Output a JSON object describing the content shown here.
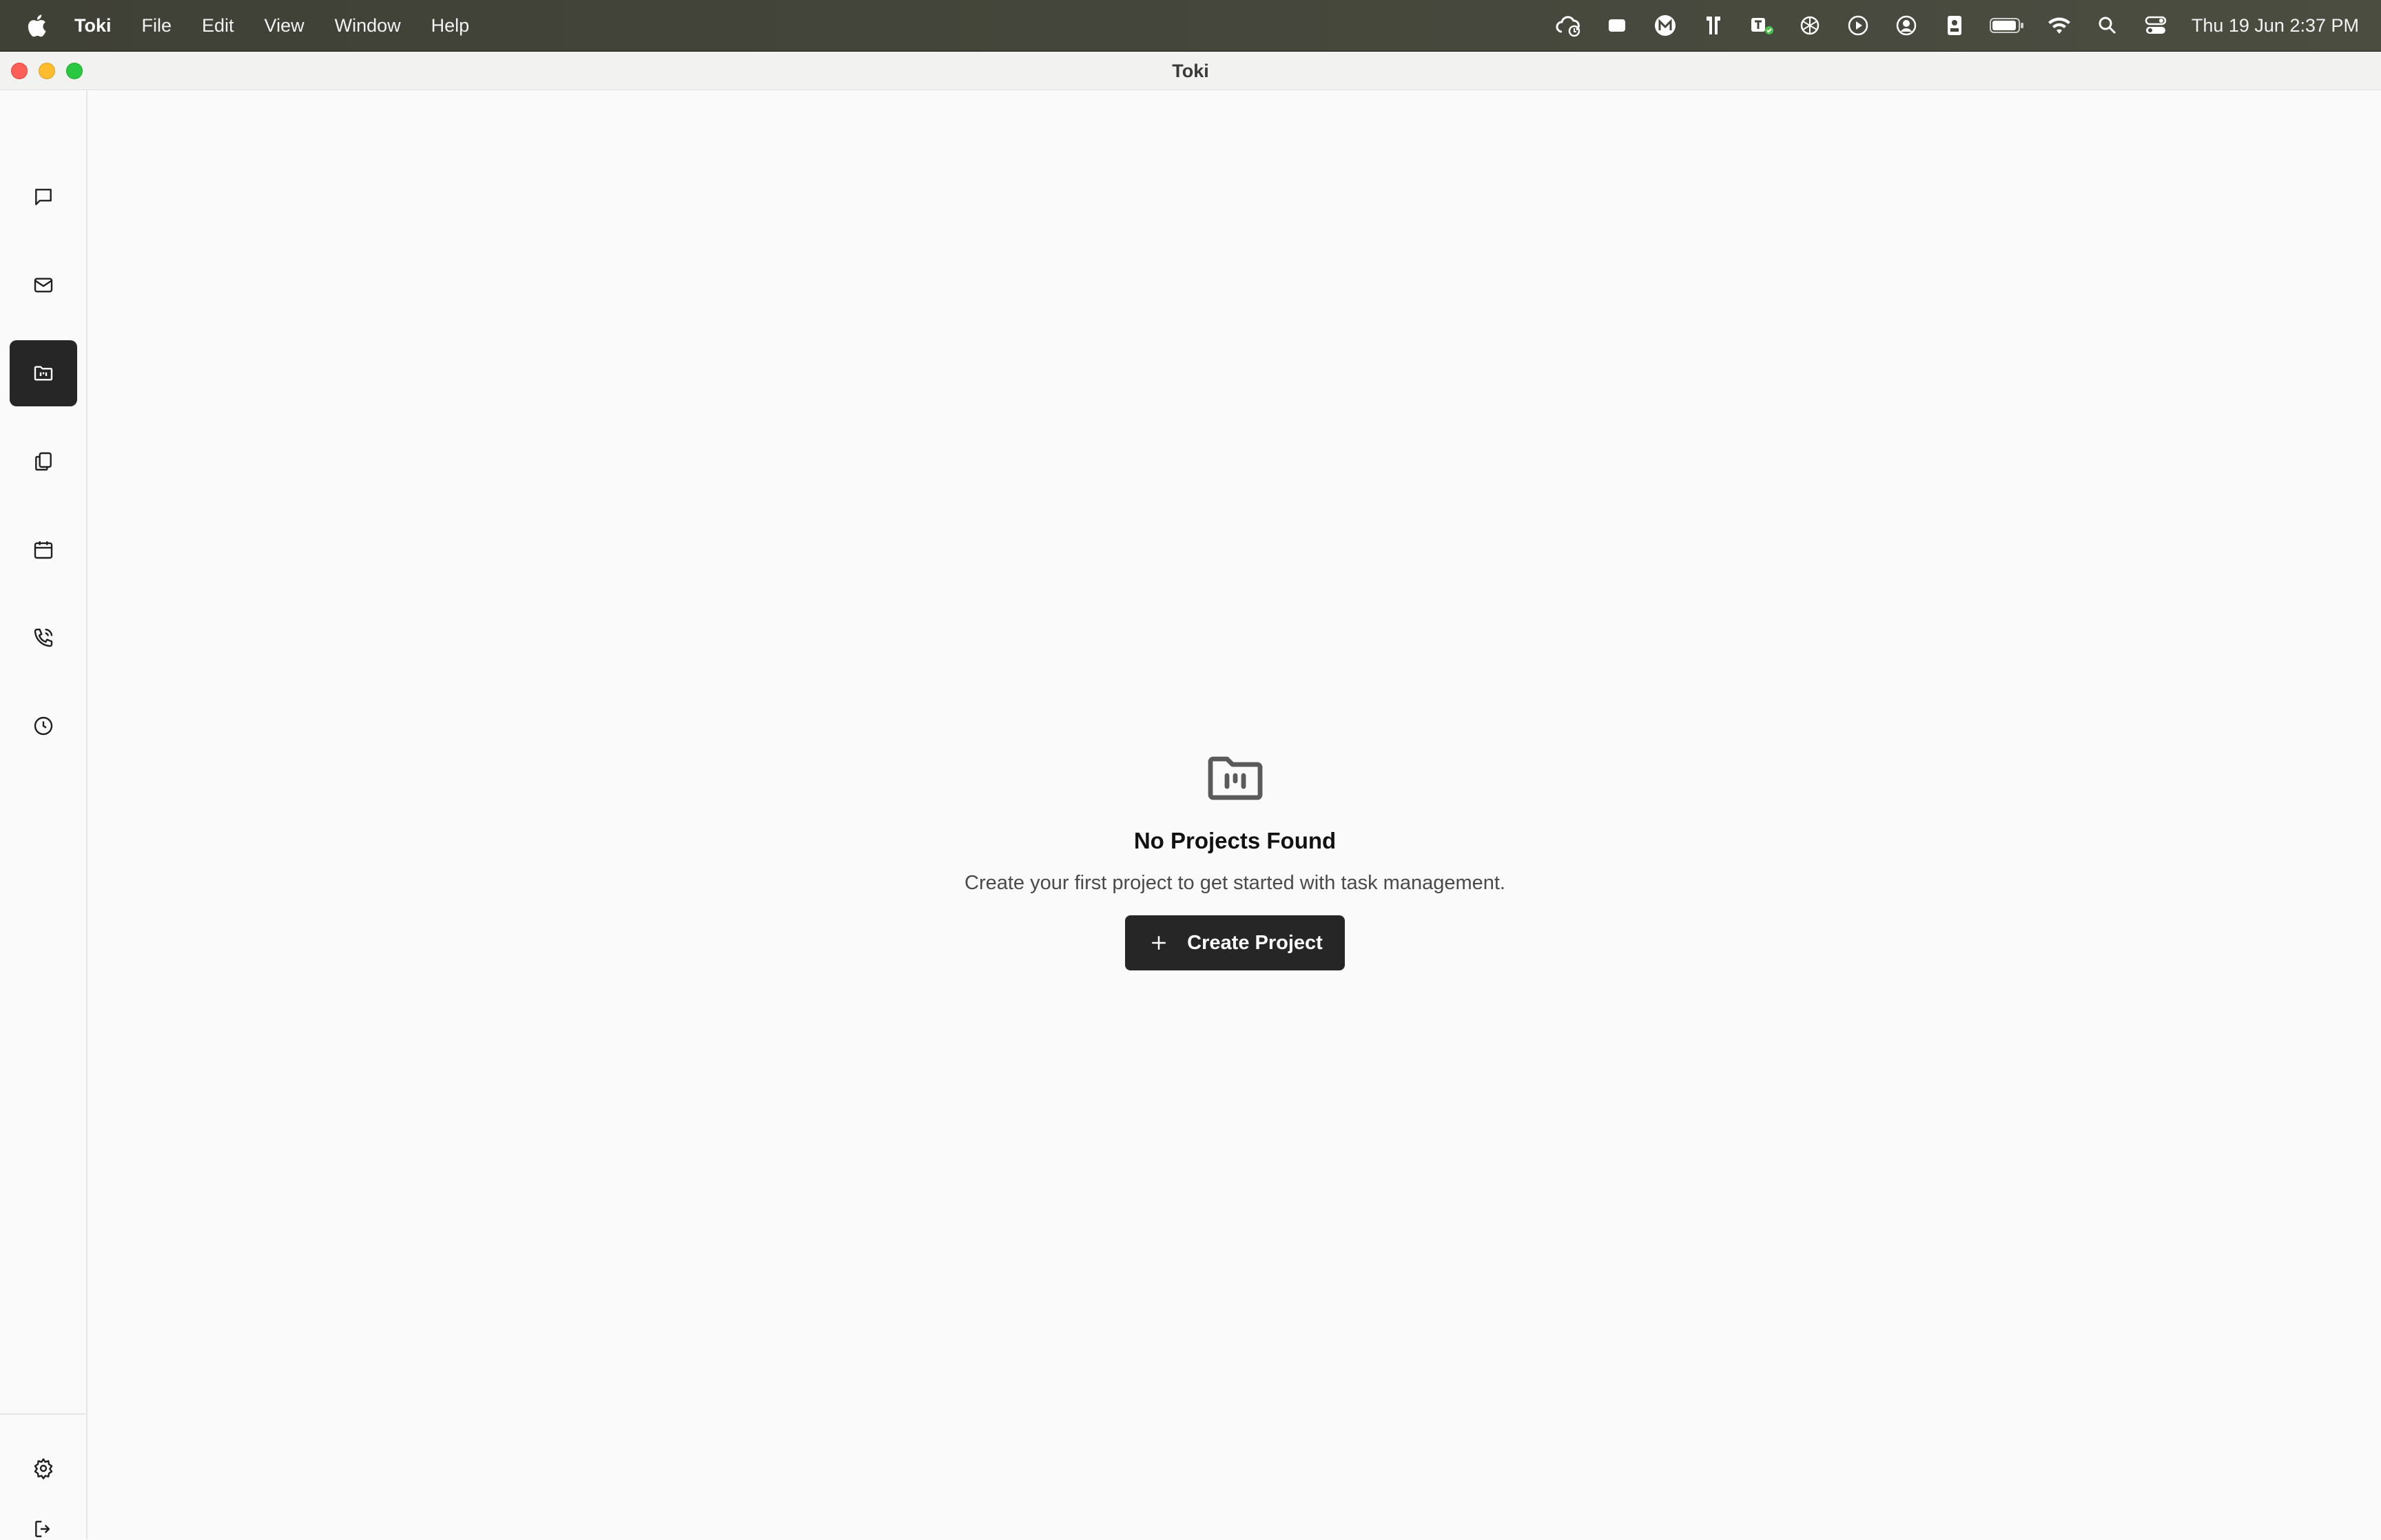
{
  "menubar": {
    "app_name": "Toki",
    "menus": [
      "File",
      "Edit",
      "View",
      "Window",
      "Help"
    ],
    "tray_icons": [
      "creative-cloud-icon",
      "screen-recorder-icon",
      "m-app-icon",
      "keyboard-icon",
      "teams-icon",
      "chatgpt-icon",
      "play-icon",
      "user-circle-icon",
      "id-badge-icon",
      "battery-icon",
      "wifi-icon",
      "spotlight-search-icon",
      "control-center-icon"
    ],
    "clock": "Thu 19 Jun  2:37 PM"
  },
  "window": {
    "title": "Toki"
  },
  "sidebar": {
    "items": [
      {
        "name": "chat-icon",
        "active": false
      },
      {
        "name": "mail-icon",
        "active": false
      },
      {
        "name": "projects-folder-icon",
        "active": true
      },
      {
        "name": "documents-icon",
        "active": false
      },
      {
        "name": "calendar-icon",
        "active": false
      },
      {
        "name": "phone-icon",
        "active": false
      },
      {
        "name": "clock-icon",
        "active": false
      }
    ],
    "bottom_items": [
      "settings-icon",
      "logout-icon"
    ]
  },
  "empty_state": {
    "icon": "folder-kanban-icon",
    "title": "No Projects Found",
    "description": "Create your first project to get started with task management.",
    "button_label": "Create Project"
  },
  "colors": {
    "accent_dark": "#262626",
    "background": "#fafafa",
    "menubar": "#44463b"
  }
}
